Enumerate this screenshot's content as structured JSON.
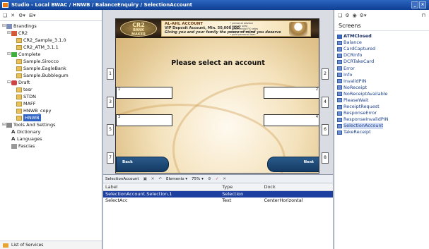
{
  "window": {
    "title": "Studio - Local BWAC / HNWB / BalanceEnquiry / SelectionAccount",
    "buttons": [
      "_",
      "×"
    ]
  },
  "left_panel": {
    "toolbar_icons": [
      "document-icon",
      "delete-icon",
      "options-icon",
      "add-icon"
    ],
    "tree": [
      {
        "label": "Brandings",
        "depth": 0,
        "icon": "brand",
        "exp": "⊟"
      },
      {
        "label": "CR2",
        "depth": 1,
        "icon": "cr2",
        "exp": "⊟"
      },
      {
        "label": "CR2_Sample_3.1.0",
        "depth": 2,
        "icon": "folder",
        "exp": ""
      },
      {
        "label": "CR2_ATM_3.1.1",
        "depth": 2,
        "icon": "folder",
        "exp": ""
      },
      {
        "label": "Complete",
        "depth": 1,
        "icon": "check",
        "exp": "⊟"
      },
      {
        "label": "Sample.Sirocco",
        "depth": 2,
        "icon": "folder",
        "exp": ""
      },
      {
        "label": "Sample.EagleBank",
        "depth": 2,
        "icon": "folder",
        "exp": ""
      },
      {
        "label": "Sample.Bubblegum",
        "depth": 2,
        "icon": "folder",
        "exp": ""
      },
      {
        "label": "Draft",
        "depth": 1,
        "icon": "draft",
        "exp": "⊟"
      },
      {
        "label": "tesr",
        "depth": 2,
        "icon": "folder",
        "exp": ""
      },
      {
        "label": "STDN",
        "depth": 2,
        "icon": "folder",
        "exp": ""
      },
      {
        "label": "MAFF",
        "depth": 2,
        "icon": "folder",
        "exp": ""
      },
      {
        "label": "HNWB_copy",
        "depth": 2,
        "icon": "folder",
        "exp": ""
      },
      {
        "label": "HNWB",
        "depth": 2,
        "icon": "folder",
        "exp": "",
        "selected": true
      },
      {
        "label": "Tools And Settings",
        "depth": 0,
        "icon": "tools",
        "exp": "⊟"
      },
      {
        "label": "Dictionary",
        "depth": 1,
        "icon": "lang",
        "exp": ""
      },
      {
        "label": "Languages",
        "depth": 1,
        "icon": "lang",
        "exp": ""
      },
      {
        "label": "Fascias",
        "depth": 1,
        "icon": "table",
        "exp": ""
      }
    ],
    "footer_label": "List of Services"
  },
  "screen": {
    "logo_top": "CR2",
    "logo_mid": "BANK",
    "logo_bottom": "MAKER",
    "ad_title": "AL-AHL ACCOUNT",
    "ad_line2": "VIP Deposit Account, Min. 50,000 JOD",
    "ad_line3": "Giving you and your family the peace of mind you deserve",
    "ad_bullets": [
      "• personal advisor",
      "• priority seat",
      "• preferential FX rates",
      "• free personal card",
      "• gold personal loan"
    ],
    "prompt": "Please select an account",
    "fdk_left": [
      "1",
      "3",
      "5",
      "7"
    ],
    "fdk_right": [
      "2",
      "4",
      "6",
      "8"
    ],
    "slot_left_1": "1",
    "slot_left_2": "3",
    "slot_right_1": "2",
    "slot_right_2": "4",
    "back_label": "Back",
    "next_label": "Next"
  },
  "props": {
    "toolbar": {
      "name": "SelectionAccount",
      "elements": "Elements ▾",
      "zoom": "75% ▾"
    },
    "columns": [
      "Label",
      "Type",
      "Dock"
    ],
    "rows": [
      {
        "label": "SelectionAccount.Selection.1",
        "type": "Selection",
        "dock": "",
        "selected": true
      },
      {
        "label": "SelectAcc",
        "type": "Text",
        "dock": "CenterHorizontal",
        "selected": false
      }
    ]
  },
  "right_panel": {
    "heading": "Screens",
    "screens": [
      {
        "label": "ATMClosed",
        "bold": true
      },
      {
        "label": "Balance"
      },
      {
        "label": "CardCaptured"
      },
      {
        "label": "DCRInfo"
      },
      {
        "label": "DCRTakeCard"
      },
      {
        "label": "Error"
      },
      {
        "label": "Info"
      },
      {
        "label": "InvalidPIN"
      },
      {
        "label": "NoReceipt"
      },
      {
        "label": "NoReceiptAvailable"
      },
      {
        "label": "PleaseWait"
      },
      {
        "label": "ReceiptRequest"
      },
      {
        "label": "ResponseError"
      },
      {
        "label": "ResponseInvalidPIN"
      },
      {
        "label": "SelectionAccount",
        "selected": true
      },
      {
        "label": "TakeReceipt"
      }
    ]
  },
  "colors": {
    "accent": "#3165c5",
    "selection_dark": "#1c3fa0",
    "screen_gold": "#e0c38c",
    "button_blue": "#143a64"
  }
}
